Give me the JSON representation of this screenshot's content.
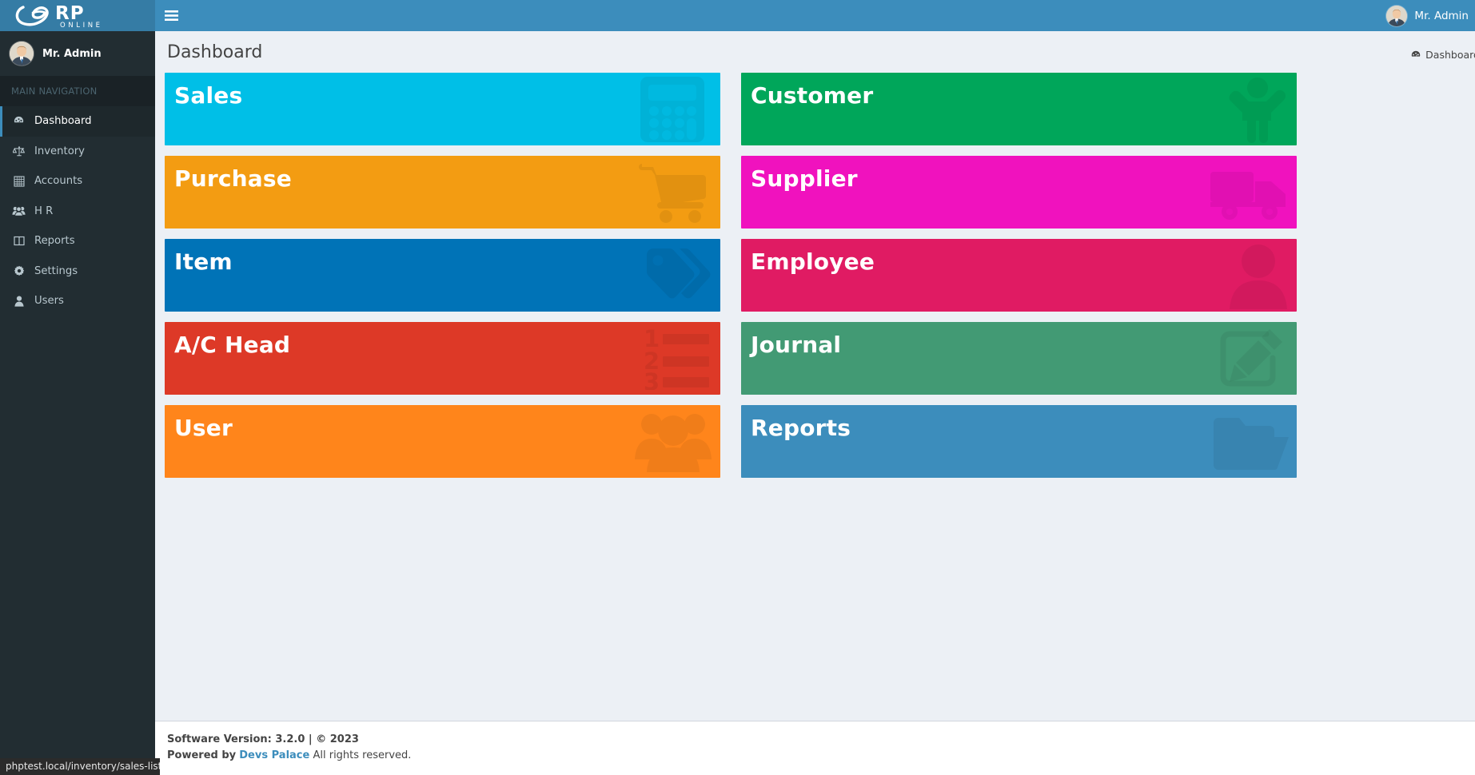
{
  "brand": {
    "logo_text": "RP",
    "logo_sub": "ONLINE",
    "header_bg": "#3c8dbc",
    "sidebar_bg": "#222d32"
  },
  "sidebar": {
    "user_name": "Mr. Admin",
    "nav_header": "MAIN NAVIGATION",
    "items": [
      {
        "label": "Dashboard",
        "icon": "dashboard-icon",
        "active": true
      },
      {
        "label": "Inventory",
        "icon": "balance-scale-icon",
        "active": false
      },
      {
        "label": "Accounts",
        "icon": "calculator-grid-icon",
        "active": false
      },
      {
        "label": "H R",
        "icon": "users-group-icon",
        "active": false
      },
      {
        "label": "Reports",
        "icon": "columns-icon",
        "active": false
      },
      {
        "label": "Settings",
        "icon": "gear-icon",
        "active": false
      },
      {
        "label": "Users",
        "icon": "user-icon",
        "active": false
      }
    ]
  },
  "topbar": {
    "menu_toggle": "hamburger-icon",
    "user_name": "Mr. Admin"
  },
  "content": {
    "page_title": "Dashboard",
    "breadcrumb": "Dashboard"
  },
  "tiles": {
    "left": [
      {
        "title": "Sales",
        "color": "#00bfe7",
        "icon": "calculator-icon"
      },
      {
        "title": "Purchase",
        "color": "#f39c12",
        "icon": "shopping-cart-icon"
      },
      {
        "title": "Item",
        "color": "#0073b7",
        "icon": "tags-icon"
      },
      {
        "title": "A/C Head",
        "color": "#dd3927",
        "icon": "numbered-list-icon"
      },
      {
        "title": "User",
        "color": "#ff851b",
        "icon": "users-group-icon"
      }
    ],
    "right": [
      {
        "title": "Customer",
        "color": "#00a65a",
        "icon": "child-icon"
      },
      {
        "title": "Supplier",
        "color": "#f012be",
        "icon": "truck-icon"
      },
      {
        "title": "Employee",
        "color": "#e01b63",
        "icon": "user-portrait-icon"
      },
      {
        "title": "Journal",
        "color": "#429a74",
        "icon": "edit-pencil-icon"
      },
      {
        "title": "Reports",
        "color": "#3c8dbc",
        "icon": "folder-open-icon"
      }
    ]
  },
  "footer": {
    "version_label": "Software Version: 3.2.0 | © 2023",
    "powered_prefix": "Powered by",
    "powered_link": "Devs Palace",
    "powered_suffix": "All rights reserved."
  },
  "status_bar": {
    "url": "phptest.local/inventory/sales-list"
  }
}
